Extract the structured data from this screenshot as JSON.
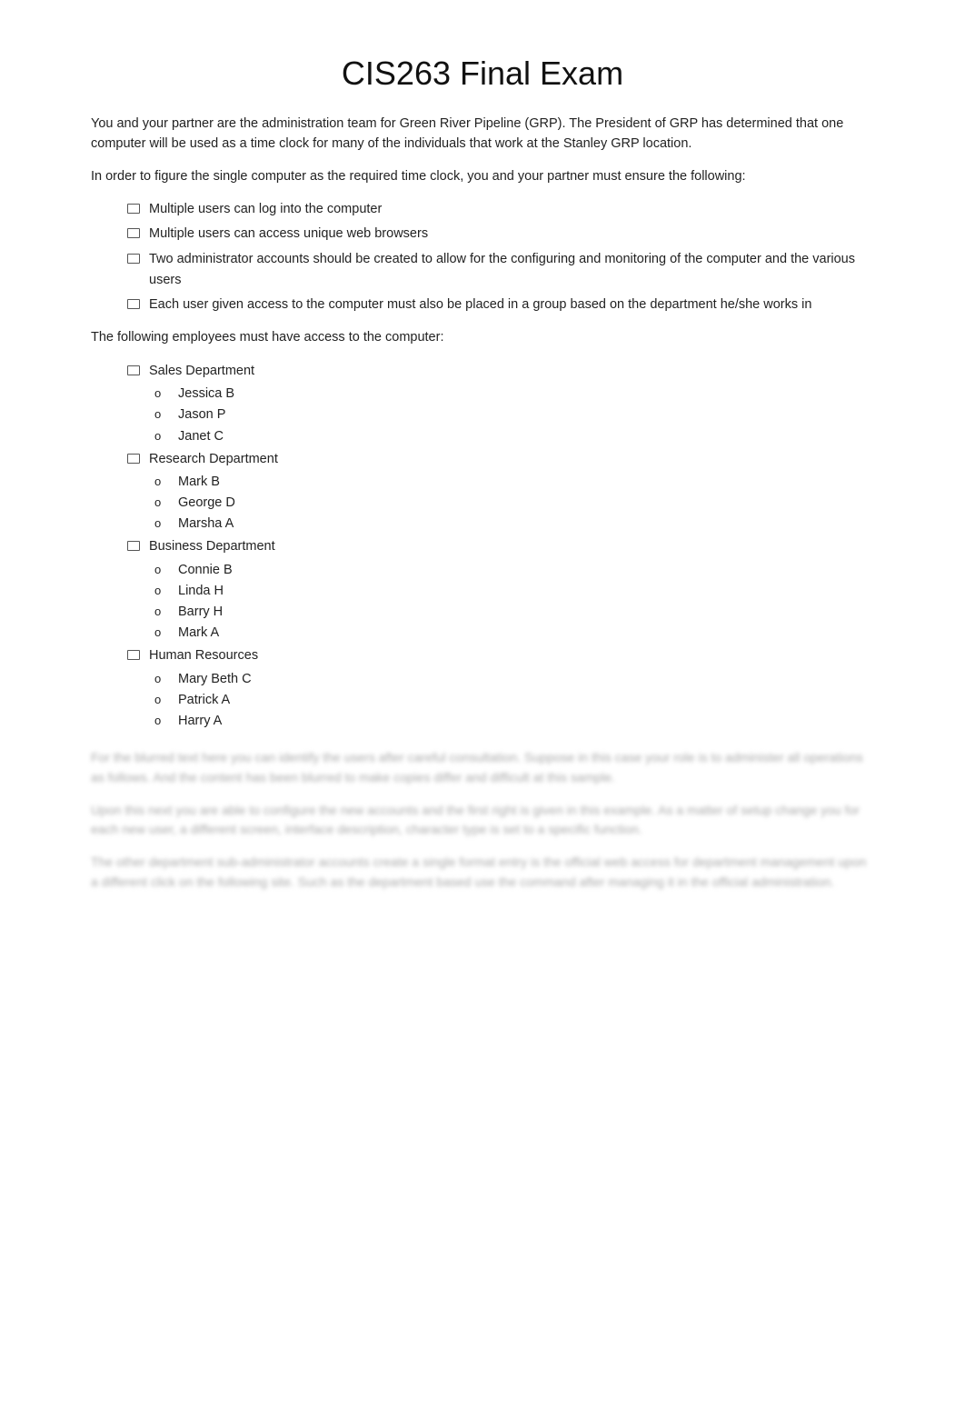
{
  "page": {
    "title": "CIS263 Final Exam",
    "intro_paragraph1": "You and your partner are the administration team for Green River Pipeline (GRP).  The President of GRP has determined that one computer will be used as a time clock for many of the individuals that work at the Stanley GRP location.",
    "intro_paragraph2": "In order to figure the single computer as the required time clock, you and your partner must ensure the following:",
    "requirements": [
      "Multiple users can log into the computer",
      "Multiple users can access unique web browsers",
      "Two administrator accounts should be created to allow for the configuring and monitoring of the computer and the various users",
      "Each user given access to the computer must also be placed in a group based on the department he/she works in"
    ],
    "employees_intro": "The following employees must have access to the computer:",
    "departments": [
      {
        "name": "Sales Department",
        "members": [
          "Jessica B",
          "Jason P",
          "Janet C"
        ]
      },
      {
        "name": "Research Department",
        "members": [
          "Mark B",
          "George D",
          "Marsha A"
        ]
      },
      {
        "name": "Business Department",
        "members": [
          "Connie B",
          "Linda H",
          "Barry H",
          "Mark A"
        ]
      },
      {
        "name": "Human Resources",
        "members": [
          "Mary Beth C",
          "Patrick A",
          "Harry A"
        ]
      }
    ],
    "blurred_paragraphs": [
      "For the blurred text here you can identify the users after careful consultation. Suppose in this case your role is to administer all operations as follows. And the content has been blurred to make copies differ and difficult at this sample.",
      "Upon this next you are able to configure the new accounts and the first right is given in this example. As a matter of setup change you for each new user, a different screen, interface description, character type is set to a specific function.",
      "The other department sub-administrator accounts create a single format entry is the official web access for department management upon a different click on the following site. Such as the department based use the command after managing it in the official administration."
    ]
  }
}
